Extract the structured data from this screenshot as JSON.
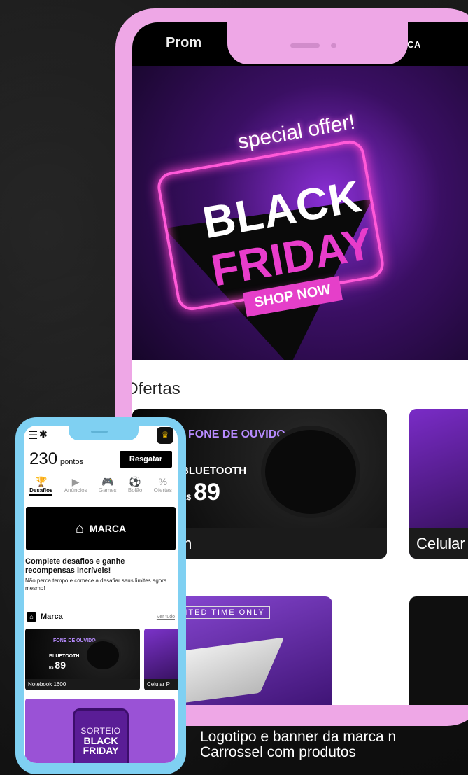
{
  "big_phone": {
    "top_left": "Prom",
    "top_right": "MARCA",
    "banner": {
      "special": "special offer!",
      "line1": "BLACK",
      "line2": "FRIDAY",
      "cta": "SHOP NOW"
    },
    "section_title": "Ofertas",
    "card1": {
      "promo": "FONE DE OUVIDO",
      "bt": "BLUETOOTH",
      "currency": "R$",
      "price": "89",
      "caption": "uetooth"
    },
    "card2": {
      "caption": "Celular"
    },
    "card3": {
      "badge": "LIMITED TIME ONLY"
    }
  },
  "small_phone": {
    "points": "230",
    "points_unit": "pontos",
    "resgatar": "Resgatar",
    "tabs": [
      {
        "label": "Desafios",
        "icon": "🏆"
      },
      {
        "label": "Anúncios",
        "icon": "▶"
      },
      {
        "label": "Games",
        "icon": "🎮"
      },
      {
        "label": "Bolão",
        "icon": "⚽"
      },
      {
        "label": "Ofertas",
        "icon": "%"
      }
    ],
    "marca_label": "MARCA",
    "desafio_title": "Complete desafios e ganhe recompensas incríveis!",
    "desafio_text": "Não perca tempo e comece a desafiar seus limites agora mesmo!",
    "section_title": "Marca",
    "ver_tudo": "Ver tudo",
    "card1": {
      "promo": "FONE DE OUVIDO",
      "bt": "BLUETOOTH",
      "currency": "R$",
      "price": "89",
      "caption": "Notebook 1600"
    },
    "card2": {
      "caption": "Celular P"
    },
    "sorteio": {
      "line1": "SORTEIO",
      "line2": "BLACK",
      "line3": "FRIDAY"
    }
  },
  "caption": {
    "line1": "Logotipo e banner da marca n",
    "line2": "Carrossel com produtos"
  },
  "colors": {
    "big_frame": "#eea7e6",
    "small_frame": "#7fd0f2",
    "accent": "#e83ccb"
  }
}
